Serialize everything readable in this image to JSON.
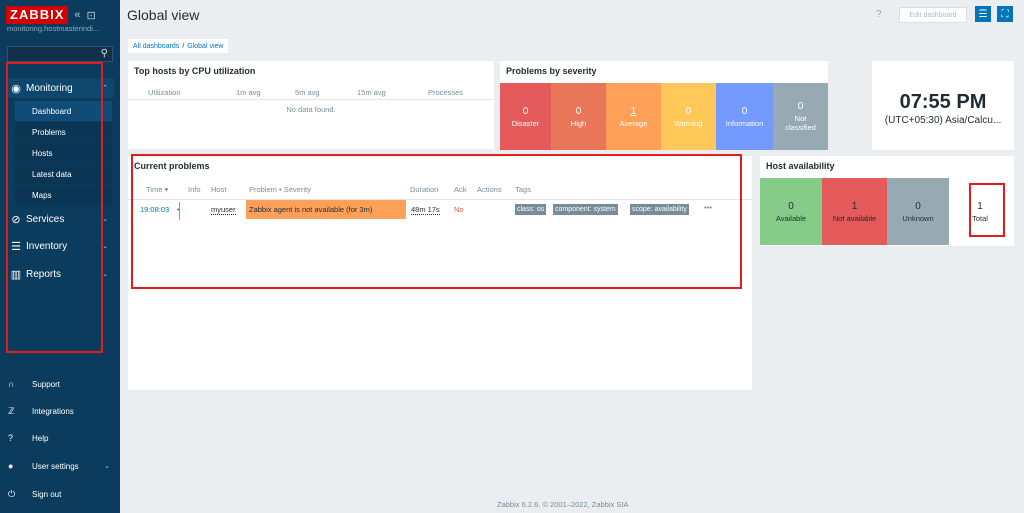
{
  "sidebar": {
    "logo": "ZABBIX",
    "collapse_icon": "«",
    "kiosk_icon": "⊡",
    "server_name": "monitoring.hostmasterindi...",
    "menu": [
      {
        "label": "Monitoring",
        "icon": "eye-icon"
      },
      {
        "label": "Services",
        "icon": "services-icon"
      },
      {
        "label": "Inventory",
        "icon": "list-icon"
      },
      {
        "label": "Reports",
        "icon": "reports-icon"
      }
    ],
    "submenu": [
      "Dashboard",
      "Problems",
      "Hosts",
      "Latest data",
      "Maps"
    ],
    "footer": [
      {
        "label": "Support",
        "icon": "headset-icon"
      },
      {
        "label": "Integrations",
        "icon": "z-icon"
      },
      {
        "label": "Help",
        "icon": "help-icon"
      },
      {
        "label": "User settings",
        "icon": "user-icon"
      },
      {
        "label": "Sign out",
        "icon": "power-icon"
      }
    ]
  },
  "header": {
    "title": "Global view",
    "help": "?",
    "edit_label": "Edit dashboard"
  },
  "breadcrumbs": {
    "all": "All dashboards",
    "sep": "/",
    "current": "Global view"
  },
  "cpu_widget": {
    "title": "Top hosts by CPU utilization",
    "columns": [
      "Utilization",
      "1m avg",
      "5m avg",
      "15m avg",
      "Processes"
    ],
    "empty": "No data found."
  },
  "severity_widget": {
    "title": "Problems by severity",
    "cells": [
      {
        "count": "0",
        "label": "Disaster",
        "color": "#e45959"
      },
      {
        "count": "0",
        "label": "High",
        "color": "#e97659"
      },
      {
        "count": "1",
        "label": "Average",
        "color": "#ffa059"
      },
      {
        "count": "0",
        "label": "Warning",
        "color": "#ffc859"
      },
      {
        "count": "0",
        "label": "Information",
        "color": "#7499ff"
      },
      {
        "count": "0",
        "label_1": "Not",
        "label_2": "classified",
        "color": "#97aab3"
      }
    ]
  },
  "clock_widget": {
    "time": "07:55 PM",
    "timezone": "(UTC+05:30) Asia/Calcu..."
  },
  "problems_widget": {
    "title": "Current problems",
    "columns": [
      "Time ▾",
      "Info",
      "Host",
      "Problem • Severity",
      "Duration",
      "Ack",
      "Actions",
      "Tags"
    ],
    "row": {
      "time": "19:08:03",
      "host": "myuser",
      "problem": "Zabbix agent is not available (for 3m)",
      "duration": "48m 17s",
      "ack": "No",
      "tags": [
        "class: os",
        "component: system",
        "scope: availability"
      ],
      "more": "•••"
    }
  },
  "availability_widget": {
    "title": "Host availability",
    "cells": [
      {
        "count": "0",
        "label": "Available",
        "color": "#86cc89"
      },
      {
        "count": "1",
        "label": "Not available",
        "color": "#e45959"
      },
      {
        "count": "0",
        "label": "Unknown",
        "color": "#97aab3"
      }
    ],
    "total": {
      "count": "1",
      "label": "Total"
    }
  },
  "footer": {
    "copyright": "Zabbix 6.2.6. © 2001–2022, Zabbix SIA"
  }
}
